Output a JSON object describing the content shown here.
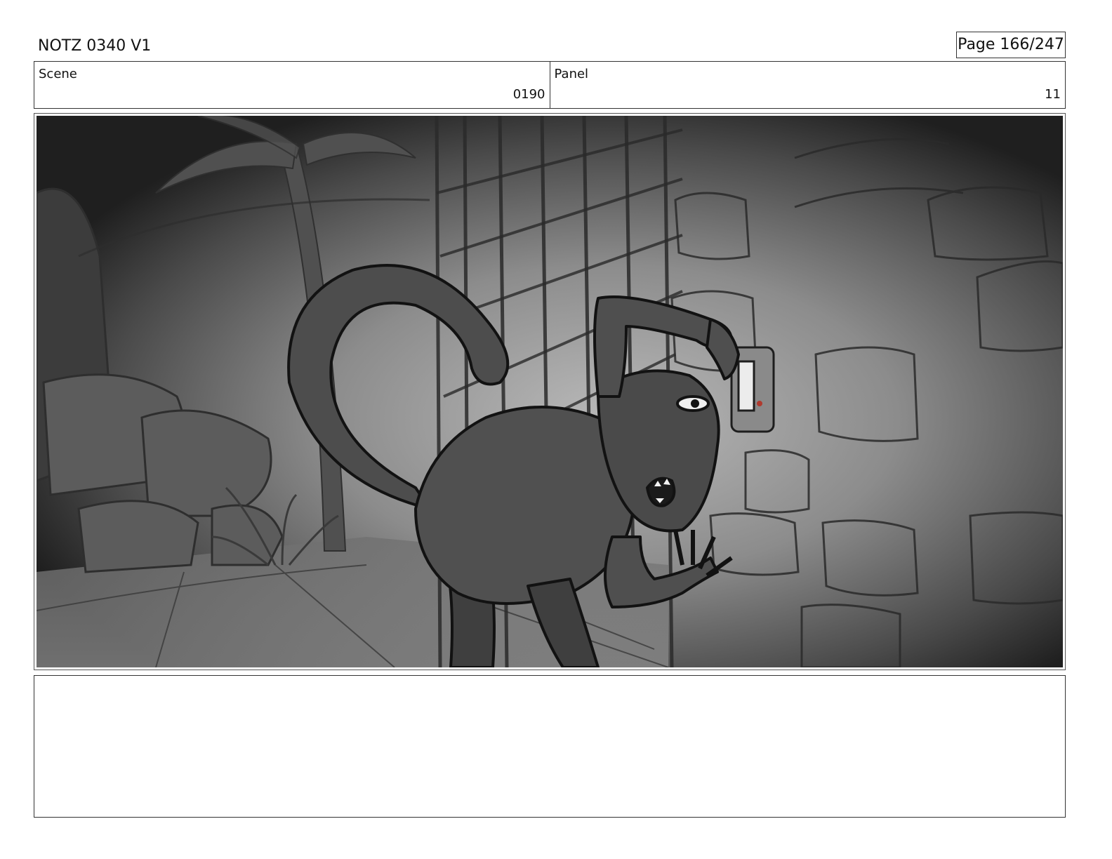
{
  "document": {
    "title": "NOTZ 0340 V1",
    "page": "Page 166/247"
  },
  "header": {
    "scene_label": "Scene",
    "scene_value": "0190",
    "panel_label": "Panel",
    "panel_value": "11"
  },
  "notes": {
    "text": ""
  }
}
